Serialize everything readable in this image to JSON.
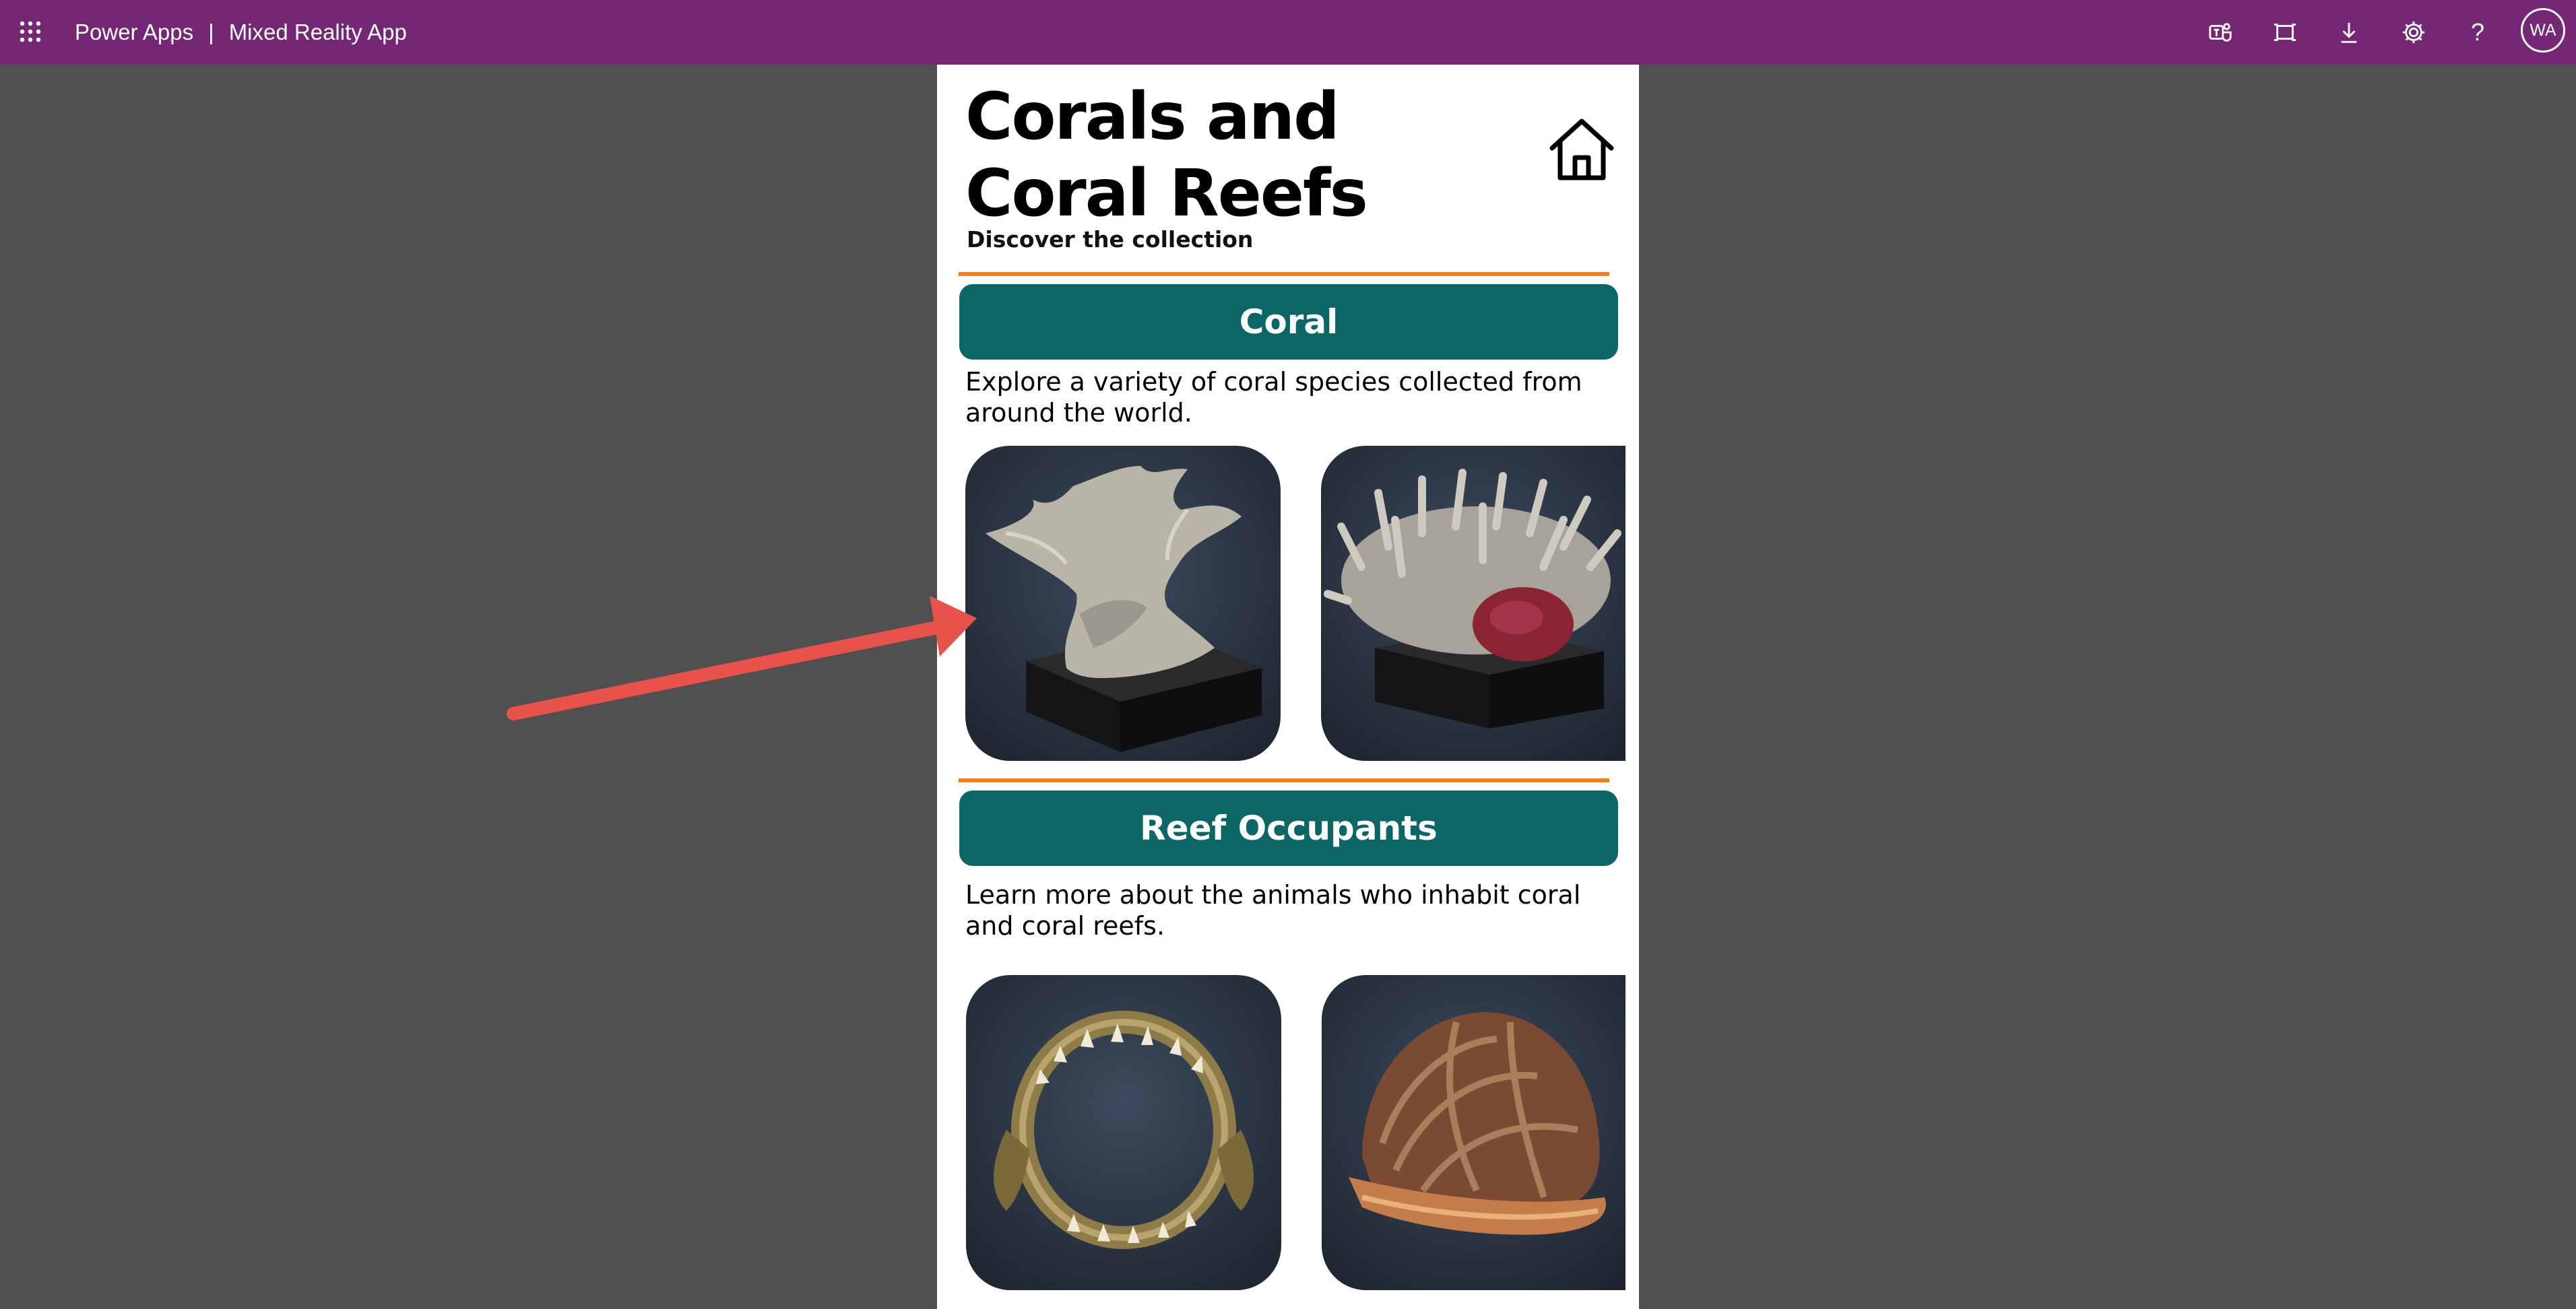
{
  "app": {
    "product": "Power Apps",
    "separator": "|",
    "name": "Mixed Reality App",
    "user_initials": "WA",
    "toolbar_icons": [
      "teams-icon",
      "fit-screen-icon",
      "download-icon",
      "settings-icon",
      "help-icon"
    ]
  },
  "page": {
    "title": "Corals and Coral Reefs",
    "subtitle": "Discover the collection",
    "home_icon": "home-icon"
  },
  "sections": [
    {
      "label": "Coral",
      "description": "Explore a variety of coral species collected from around the world.",
      "items": [
        "branching-coral-image",
        "staghorn-coral-image"
      ]
    },
    {
      "label": "Reef Occupants",
      "description": "Learn more about the animals who inhabit coral and coral reefs.",
      "items": [
        "shark-jaw-image",
        "conch-shell-image"
      ]
    }
  ],
  "colors": {
    "topbar": "#742774",
    "section_button": "#0c6666",
    "divider": "#f07f1f",
    "annotation_arrow": "#e8524a",
    "backdrop": "#505050"
  }
}
